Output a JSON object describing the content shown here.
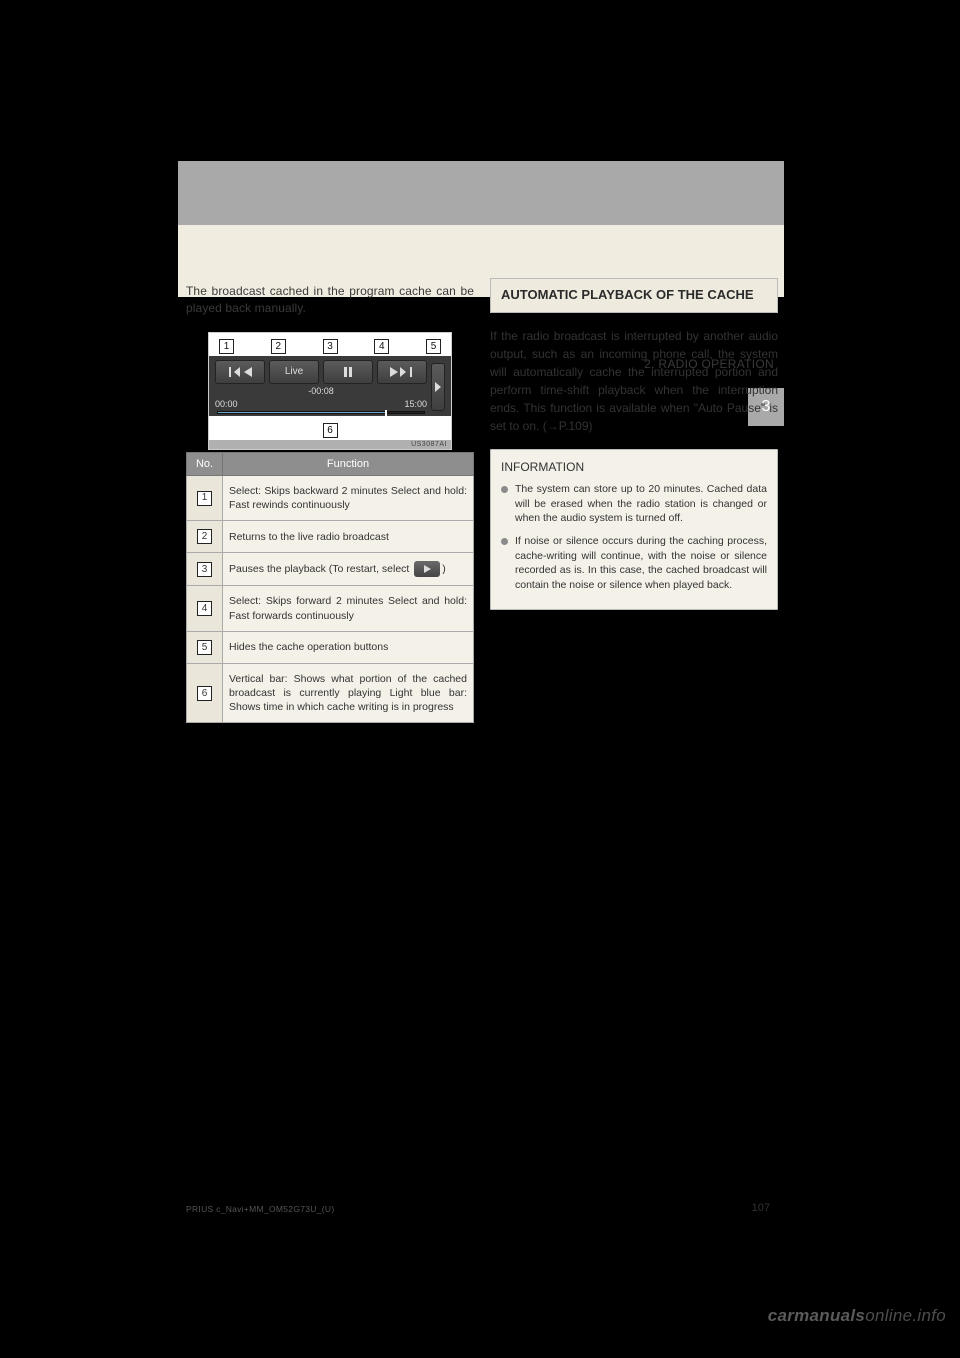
{
  "section_label": "2. RADIO OPERATION",
  "page_tab": "3",
  "left": {
    "intro": "The broadcast cached in the program cache can be played back manually.",
    "device": {
      "numbers": [
        "1",
        "2",
        "3",
        "4",
        "5"
      ],
      "offset": "-00:08",
      "time_left": "00:00",
      "time_right": "15:00",
      "live_label": "Live",
      "bottom_number": "6",
      "img_code": "US3087AI"
    },
    "table": {
      "head_no": "No.",
      "head_func": "Function",
      "rows": [
        {
          "num": "1",
          "text": "Select: Skips backward 2 minutes\nSelect and hold: Fast rewinds continuously"
        },
        {
          "num": "2",
          "text": "Returns to the live radio broadcast"
        },
        {
          "num": "3",
          "text_pre": "Pauses the playback (To restart, select ",
          "text_post": ")"
        },
        {
          "num": "4",
          "text": "Select: Skips forward 2 minutes\nSelect and hold: Fast forwards continuously"
        },
        {
          "num": "5",
          "text": "Hides the cache operation buttons"
        },
        {
          "num": "6",
          "text": "Vertical bar: Shows what portion of the cached broadcast is currently playing\nLight blue bar: Shows time in which cache writing is in progress"
        }
      ]
    }
  },
  "right": {
    "subhead": "AUTOMATIC PLAYBACK OF THE CACHE",
    "para": "If the radio broadcast is interrupted by another audio output, such as an incoming phone call, the system will automatically cache the interrupted portion and perform time-shift playback when the interruption ends. This function is available when \"Auto Pause\" is set to on. (→P.109)",
    "info_title": "INFORMATION",
    "bullets": [
      "The system can store up to 20 minutes. Cached data will be erased when the radio station is changed or when the audio system is turned off.",
      "If noise or silence occurs during the caching process, cache-writing will continue, with the noise or silence recorded as is. In this case, the cached broadcast will contain the noise or silence when played back."
    ]
  },
  "footer_left": "PRIUS c_Navi+MM_OM52G73U_(U)",
  "page_number": "107",
  "watermark_a": "carmanuals",
  "watermark_b": "online.info"
}
